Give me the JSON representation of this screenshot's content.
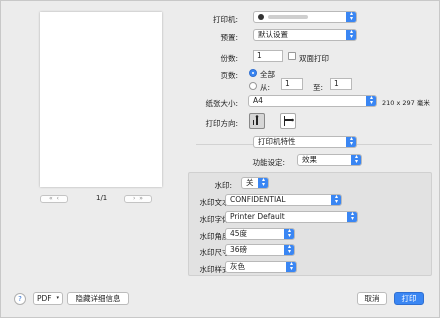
{
  "printer": {
    "label": "打印机:",
    "value": ""
  },
  "presets": {
    "label": "预置:",
    "value": "默认设置"
  },
  "copies": {
    "label": "份数:",
    "value": "1",
    "duplex_label": "双面打印"
  },
  "pages": {
    "label": "页数:",
    "all_label": "全部",
    "from_label": "从:",
    "from_value": "1",
    "to_label": "至:",
    "to_value": "1"
  },
  "paper": {
    "label": "纸张大小:",
    "value": "A4",
    "dims": "210 x 297 毫米"
  },
  "orientation": {
    "label": "打印方向:"
  },
  "section": {
    "value": "打印机特性"
  },
  "feature_set": {
    "label": "功能设定:",
    "value": "效果"
  },
  "watermark": {
    "enable": {
      "label": "水印:",
      "value": "关"
    },
    "text": {
      "label": "水印文本:",
      "value": "CONFIDENTIAL"
    },
    "font": {
      "label": "水印字体:",
      "value": "Printer Default"
    },
    "angle": {
      "label": "水印角度:",
      "value": "45度"
    },
    "size": {
      "label": "水印尺寸:",
      "value": "36磅"
    },
    "style": {
      "label": "水印样式:",
      "value": "灰色"
    }
  },
  "preview": {
    "page_indicator": "1/1"
  },
  "footer": {
    "help": "?",
    "pdf": "PDF",
    "hide_details": "隐藏详细信息",
    "cancel": "取消",
    "print": "打印"
  },
  "colors": {
    "accent": "#3a86f3",
    "background": "#ececec"
  }
}
